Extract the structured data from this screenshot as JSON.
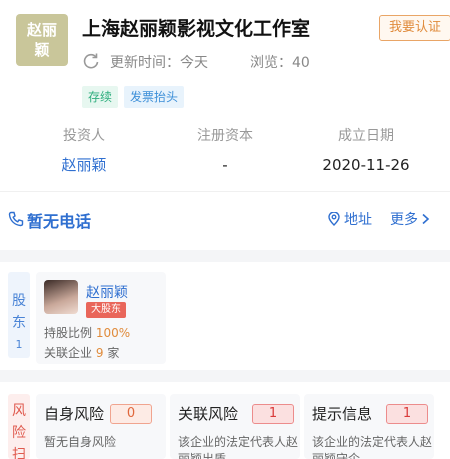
{
  "company": {
    "logo_text": "赵丽颖",
    "name": "上海赵丽颖影视文化工作室",
    "certify_label": "我要认证",
    "update_label": "更新时间：今天",
    "views_label": "浏览：40",
    "tags": [
      "存续",
      "发票抬头"
    ]
  },
  "info": [
    {
      "label": "投资人",
      "value": "赵丽颖"
    },
    {
      "label": "注册资本",
      "value": "-"
    },
    {
      "label": "成立日期",
      "value": "2020-11-26"
    }
  ],
  "contact": {
    "phone_text": "暂无电话",
    "address_label": "地址",
    "more_label": "更多"
  },
  "shareholder": {
    "tab_chars": [
      "股",
      "东"
    ],
    "tab_count": "1",
    "name": "赵丽颖",
    "badge": "大股东",
    "ratio_label": "持股比例",
    "ratio_value": "100%",
    "related_label": "关联企业",
    "related_value": "9",
    "related_unit": "家"
  },
  "risk": {
    "tab_chars": [
      "风",
      "险",
      "扫"
    ],
    "cards": [
      {
        "title": "自身风险",
        "count": "0",
        "desc": "暂无自身风险"
      },
      {
        "title": "关联风险",
        "count": "1",
        "desc": "该企业的法定代表人赵丽颖出质…"
      },
      {
        "title": "提示信息",
        "count": "1",
        "desc": "该企业的法定代表人赵丽颖守企…"
      }
    ]
  },
  "colors": {
    "accent_blue": "#2f6fd0",
    "tag_green": "#2fae7e",
    "risk_red": "#d93a3a",
    "orange": "#e08b3b"
  }
}
